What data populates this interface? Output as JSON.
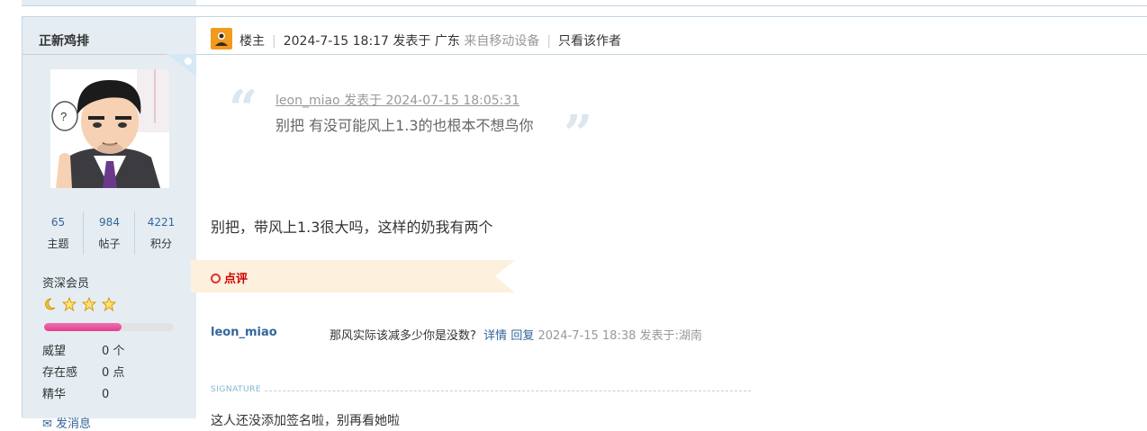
{
  "author": {
    "name": "正新鸡排",
    "stats": [
      {
        "value": "65",
        "label": "主题"
      },
      {
        "value": "984",
        "label": "帖子"
      },
      {
        "value": "4221",
        "label": "积分"
      }
    ],
    "grade": "资深会员",
    "progress_fraction": 0.6,
    "attributes": [
      {
        "key": "威望",
        "value": "0 个"
      },
      {
        "key": "存在感",
        "value": "0 点"
      },
      {
        "key": "精华",
        "value": "0"
      }
    ],
    "more_label": "发消息"
  },
  "post_header": {
    "role": "楼主",
    "posted_at": "2024-7-15 18:17",
    "posted_in_label": "发表于",
    "location": "广东",
    "device": "来自移动设备",
    "only_author": "只看该作者"
  },
  "quote": {
    "meta": "leon_miao 发表于 2024-07-15 18:05:31",
    "text": "别把 有没可能风上1.3的也根本不想鸟你"
  },
  "body_text": "别把，带风上1.3很大吗，这样的奶我有两个",
  "review": {
    "label": "点评"
  },
  "comment": {
    "user": "leon_miao",
    "text": "那风实际该减多少你是没数?",
    "detail": "详情",
    "reply": "回复",
    "meta": "2024-7-15 18:38 发表于:湖南"
  },
  "signature": {
    "label": "SIGNATURE",
    "text": "这人还没添加签名啦，别再看她啦"
  },
  "colors": {
    "link": "#336699",
    "sidebar": "#e5edf2",
    "border": "#c2d5e3"
  }
}
